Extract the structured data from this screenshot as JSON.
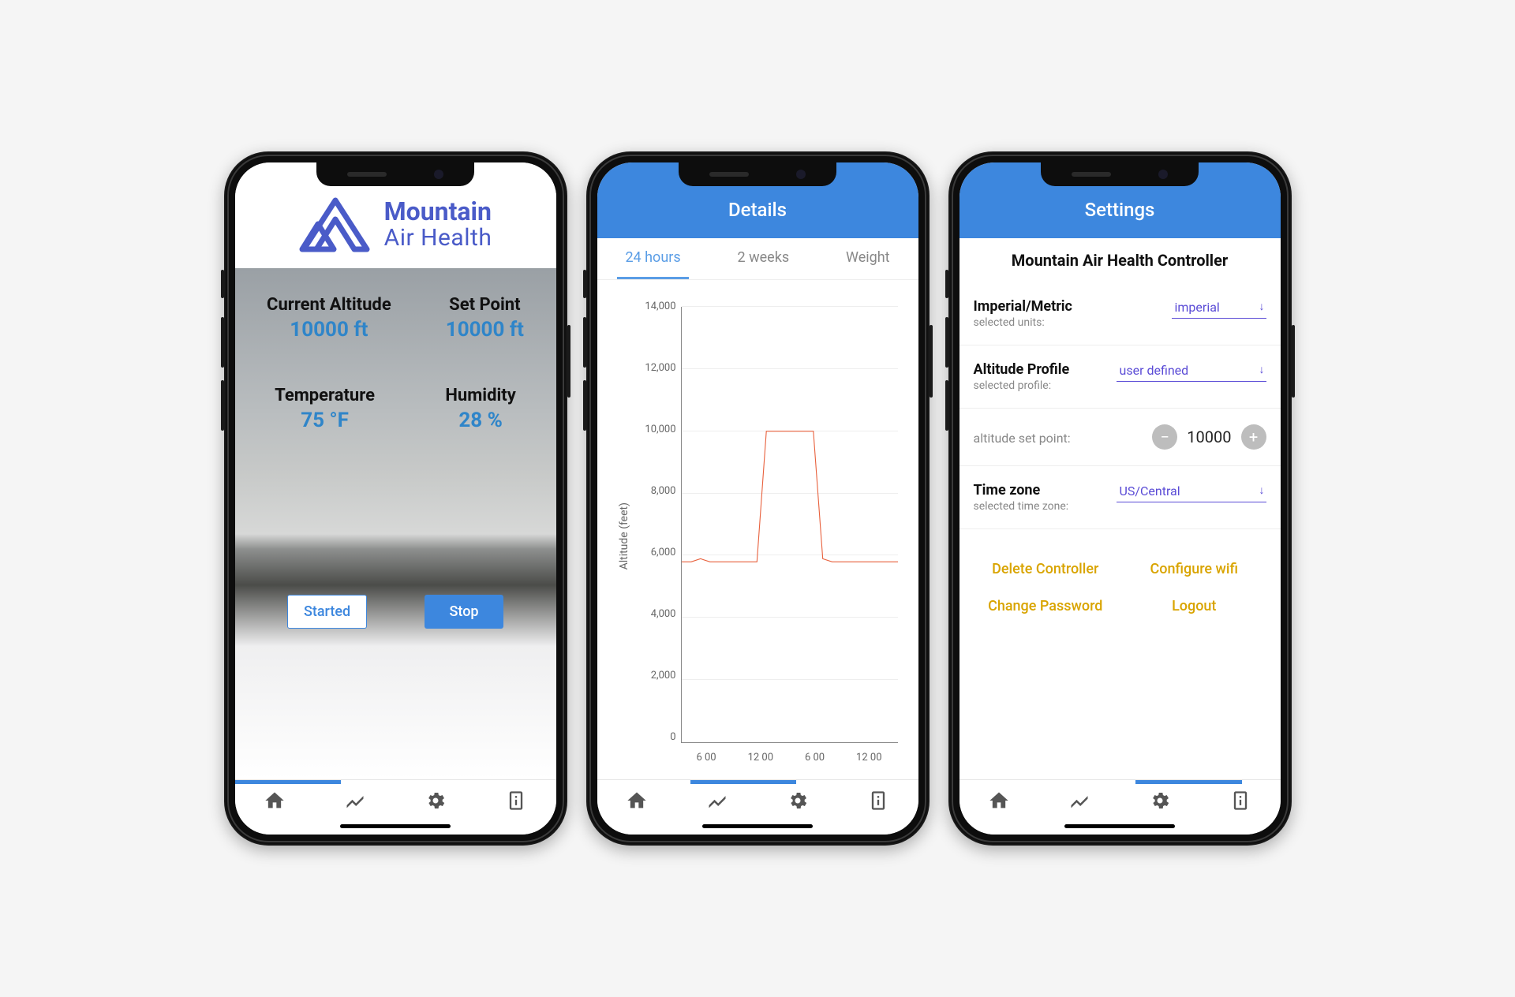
{
  "brand": {
    "line1": "Mountain",
    "line2": "Air Health"
  },
  "home": {
    "stats": {
      "current_alt_label": "Current Altitude",
      "current_alt_value": "10000 ft",
      "set_point_label": "Set Point",
      "set_point_value": "10000 ft",
      "temp_label": "Temperature",
      "temp_value": "75 °F",
      "humidity_label": "Humidity",
      "humidity_value": "28 %"
    },
    "started_btn": "Started",
    "stop_btn": "Stop"
  },
  "details": {
    "header": "Details",
    "tabs": {
      "t1": "24 hours",
      "t2": "2 weeks",
      "t3": "Weight"
    }
  },
  "settings": {
    "header": "Settings",
    "title": "Mountain Air Health Controller",
    "units": {
      "heading": "Imperial/Metric",
      "sub": "selected units:",
      "value": "imperial"
    },
    "profile": {
      "heading": "Altitude Profile",
      "sub": "selected profile:",
      "value": "user defined"
    },
    "setpoint": {
      "label": "altitude set point:",
      "value": "10000"
    },
    "tz": {
      "heading": "Time zone",
      "sub": "selected time zone:",
      "value": "US/Central"
    },
    "actions": {
      "delete": "Delete Controller",
      "wifi": "Configure wifi",
      "pwd": "Change Password",
      "logout": "Logout"
    }
  },
  "chart_data": {
    "type": "line",
    "title": "",
    "xlabel": "",
    "ylabel": "Altitude (feet)",
    "ylim": [
      0,
      14000
    ],
    "yticks": [
      0,
      2000,
      4000,
      6000,
      8000,
      10000,
      12000,
      14000
    ],
    "xticks": [
      "6 00",
      "12 00",
      "6 00",
      "12 00"
    ],
    "x": [
      0,
      1,
      2,
      3,
      4,
      5,
      6,
      7,
      8,
      9,
      10,
      11,
      12,
      13,
      14,
      15,
      16,
      17,
      18,
      19,
      20,
      21,
      22,
      23
    ],
    "values": [
      5800,
      5800,
      5900,
      5800,
      5800,
      5800,
      5800,
      5800,
      5800,
      10000,
      10000,
      10000,
      10000,
      10000,
      10000,
      5900,
      5800,
      5800,
      5800,
      5800,
      5800,
      5800,
      5800,
      5800
    ]
  }
}
